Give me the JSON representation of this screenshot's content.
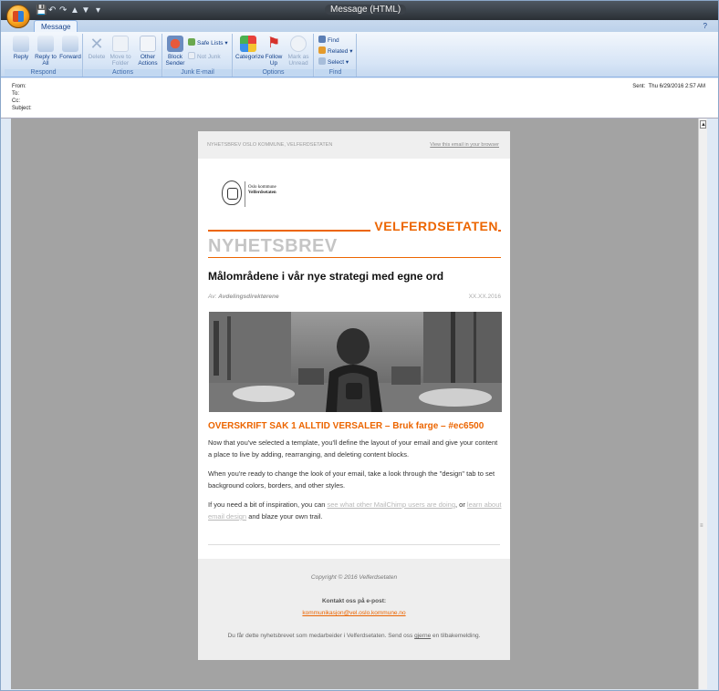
{
  "window": {
    "title": "Message (HTML)"
  },
  "quick_access": {
    "items": [
      "save",
      "undo",
      "redo",
      "prev",
      "next"
    ]
  },
  "tabs": [
    {
      "label": "Message"
    }
  ],
  "ribbon": {
    "groups": [
      {
        "label": "Respond"
      },
      {
        "label": "Actions"
      },
      {
        "label": "Junk E-mail"
      },
      {
        "label": "Options"
      },
      {
        "label": "Find"
      }
    ],
    "buttons": {
      "reply": "Reply",
      "reply_all": "Reply to All",
      "forward": "Forward",
      "delete": "Delete",
      "move_to_folder": "Move to Folder",
      "other_actions": "Other Actions",
      "block_sender": "Block Sender",
      "safe_lists": "Safe Lists",
      "not_junk": "Not Junk",
      "categorize": "Categorize",
      "follow_up": "Follow Up",
      "mark_as_unread": "Mark as Unread",
      "find": "Find",
      "related": "Related",
      "select": "Select"
    }
  },
  "header": {
    "from_label": "From:",
    "to_label": "To:",
    "cc_label": "Cc:",
    "subject_label": "Subject:",
    "sent_label": "Sent:",
    "sent_value": "Thu 6/29/2016 2:57 AM"
  },
  "email": {
    "preheader": "NYHETSBREV OSLO KOMMUNE, VELFERDSETATEN",
    "view_in_browser": "View this email in your browser",
    "org_line1": "Oslo kommune",
    "org_line2": "Velferdsetaten",
    "agency": "VELFERDSETATEN",
    "newsletter": "NYHETSBREV",
    "headline": "Målområdene i vår nye strategi med egne ord",
    "byline_prefix": "Av:",
    "byline_author": "Avdelingsdirektørene",
    "date": "XX.XX.2016",
    "section_heading": "OVERSKRIFT SAK 1 ALLTID VERSALER – Bruk farge – #ec6500",
    "para1": "Now that you've selected a template, you'll define the layout of your email and give your content a place to live by adding, rearranging, and deleting content blocks.",
    "para2": "When you're ready to change the look of your email, take a look through the \"design\" tab to set background colors, borders, and other styles.",
    "para3_a": "If you need a bit of inspiration, you can ",
    "para3_link1": "see what other MailChimp users are doing",
    "para3_b": ", or ",
    "para3_link2": "learn about email design",
    "para3_c": " and blaze your own trail.",
    "copyright": "Copyright © 2016 Velferdsetaten",
    "contact_label": "Kontakt oss på e-post:",
    "contact_email": "kommunikasjon@vel.oslo.kommune.no",
    "note_a": "Du får dette nyhetsbrevet som medarbeider i Velferdsetaten. Send oss ",
    "note_link": "gjerne",
    "note_b": " en tilbakemelding."
  },
  "colors": {
    "accent": "#ec6500",
    "ribbon_text": "#15428b"
  }
}
